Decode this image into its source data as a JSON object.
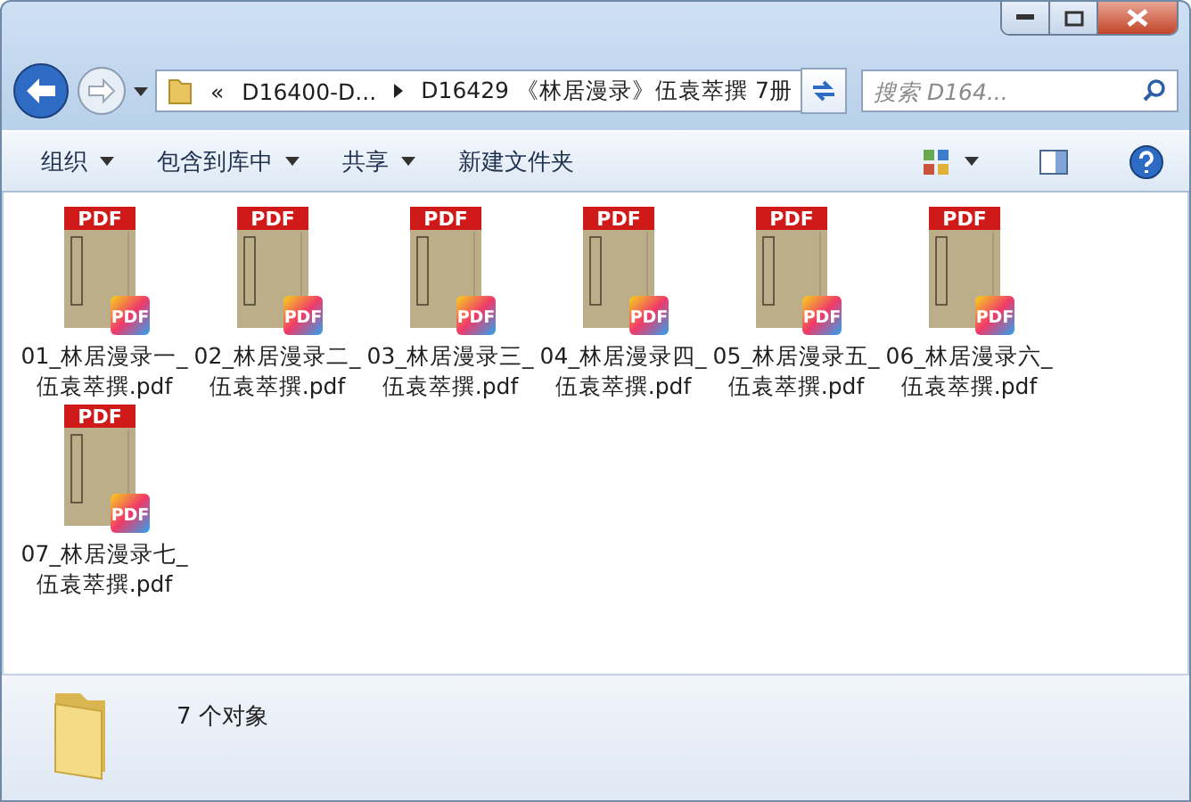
{
  "address": {
    "overflow": "«",
    "crumbs": [
      "D16400-D...",
      "D16429 《林居漫录》伍袁萃撰 7册"
    ]
  },
  "search": {
    "placeholder": "搜索 D164..."
  },
  "toolbar": [
    "组织",
    "包含到库中",
    "共享",
    "新建文件夹"
  ],
  "files": [
    {
      "name": "01_林居漫录一_伍袁萃撰.pdf",
      "cover_label": "PDF",
      "badge": "PDF"
    },
    {
      "name": "02_林居漫录二_伍袁萃撰.pdf",
      "cover_label": "PDF",
      "badge": "PDF"
    },
    {
      "name": "03_林居漫录三_伍袁萃撰.pdf",
      "cover_label": "PDF",
      "badge": "PDF"
    },
    {
      "name": "04_林居漫录四_伍袁萃撰.pdf",
      "cover_label": "PDF",
      "badge": "PDF"
    },
    {
      "name": "05_林居漫录五_伍袁萃撰.pdf",
      "cover_label": "PDF",
      "badge": "PDF"
    },
    {
      "name": "06_林居漫录六_伍袁萃撰.pdf",
      "cover_label": "PDF",
      "badge": "PDF"
    },
    {
      "name": "07_林居漫录七_伍袁萃撰.pdf",
      "cover_label": "PDF",
      "badge": "PDF"
    }
  ],
  "status_bar": {
    "text": "7 个对象"
  }
}
